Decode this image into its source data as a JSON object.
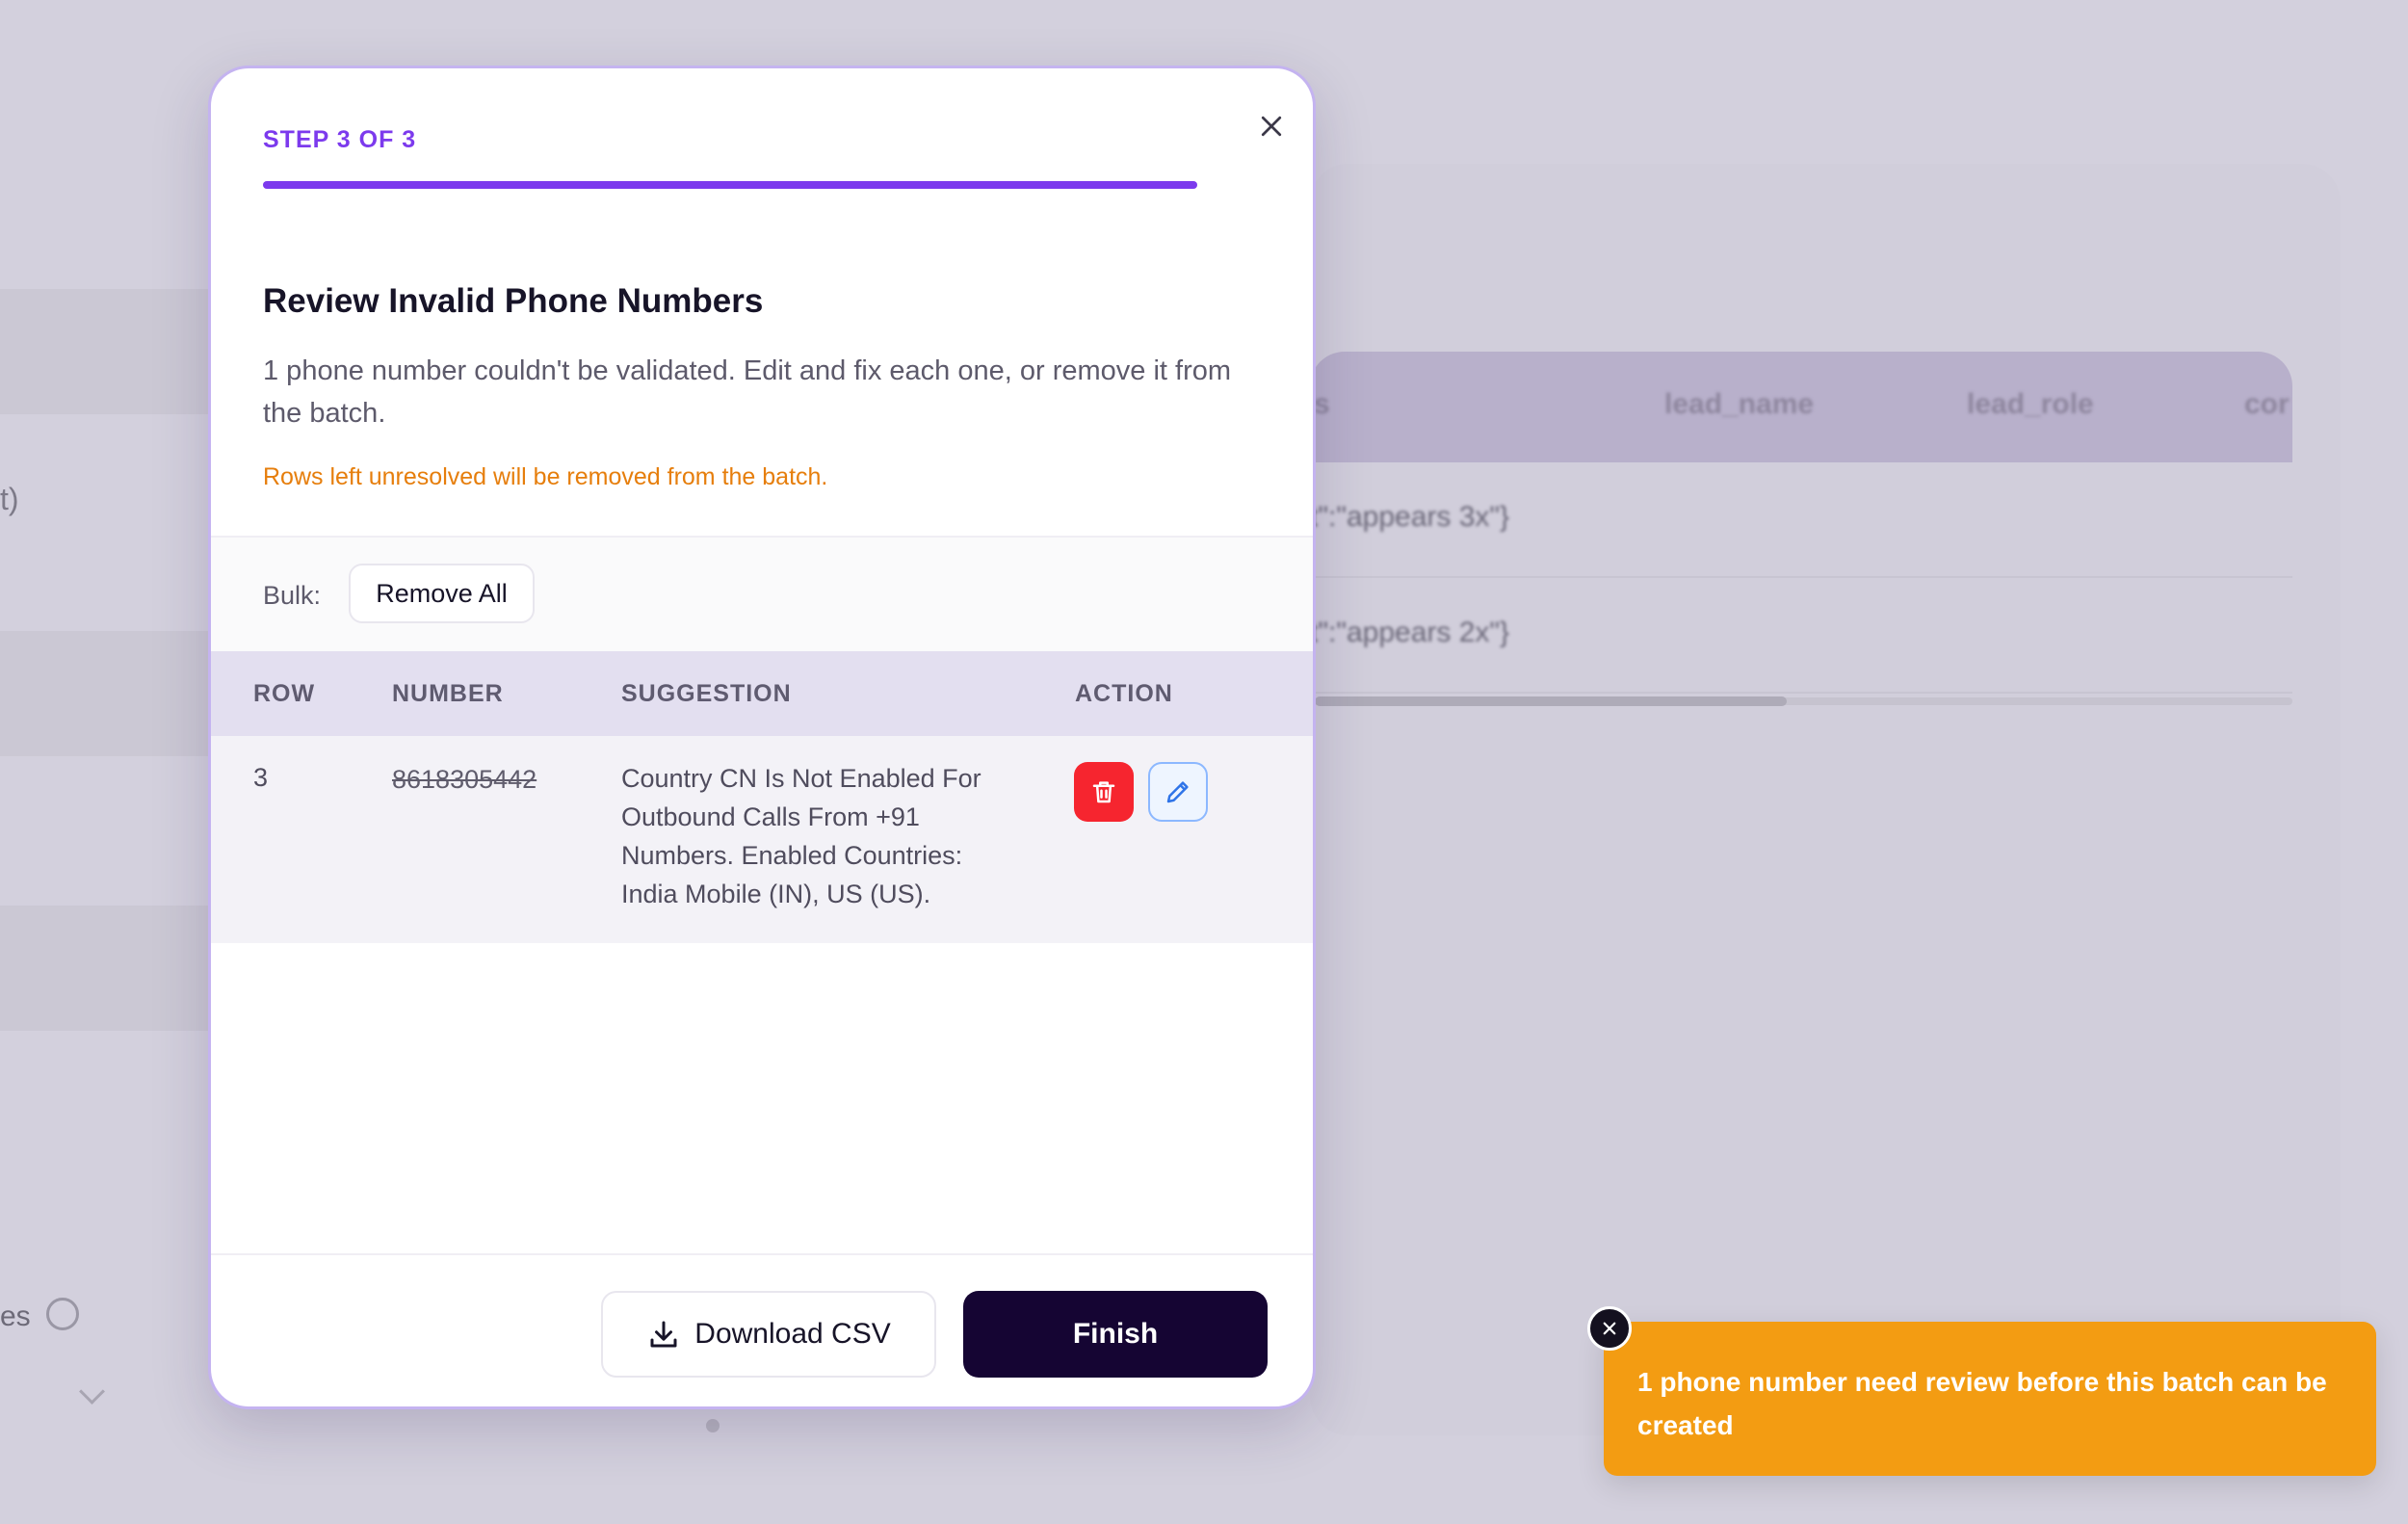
{
  "background": {
    "left_label_fragment": "t)",
    "left_info_fragment": "es",
    "table_headers": [
      "s",
      "lead_name",
      "lead_role",
      "cor"
    ],
    "table_rows": [
      "t\":\"appears 3x\"}",
      "t\":\"appears 2x\"}"
    ]
  },
  "modal": {
    "step_label": "STEP 3 OF 3",
    "progress": 1.0,
    "title": "Review Invalid Phone Numbers",
    "description": "1 phone number couldn't be validated. Edit and fix each one, or remove it from the batch.",
    "warning": "Rows left unresolved will be removed from the batch.",
    "bulk_label": "Bulk:",
    "remove_all_label": "Remove All",
    "table": {
      "headers": {
        "row": "ROW",
        "number": "NUMBER",
        "suggestion": "SUGGESTION",
        "action": "ACTION"
      },
      "rows": [
        {
          "row": "3",
          "number": "8618305442",
          "suggestion": "Country CN Is Not Enabled For Outbound Calls From +91 Numbers. Enabled Countries: India Mobile (IN), US (US)."
        }
      ]
    },
    "download_label": "Download CSV",
    "finish_label": "Finish"
  },
  "toast": {
    "message": "1 phone number need review before this batch can be created",
    "color": "#f39c12"
  },
  "colors": {
    "accent": "#7c3aed",
    "warning": "#e67e0c",
    "danger": "#f6252f",
    "primary_button": "#150533"
  },
  "icons": [
    "close-icon",
    "trash-icon",
    "pencil-icon",
    "download-icon",
    "toast-close-icon"
  ]
}
